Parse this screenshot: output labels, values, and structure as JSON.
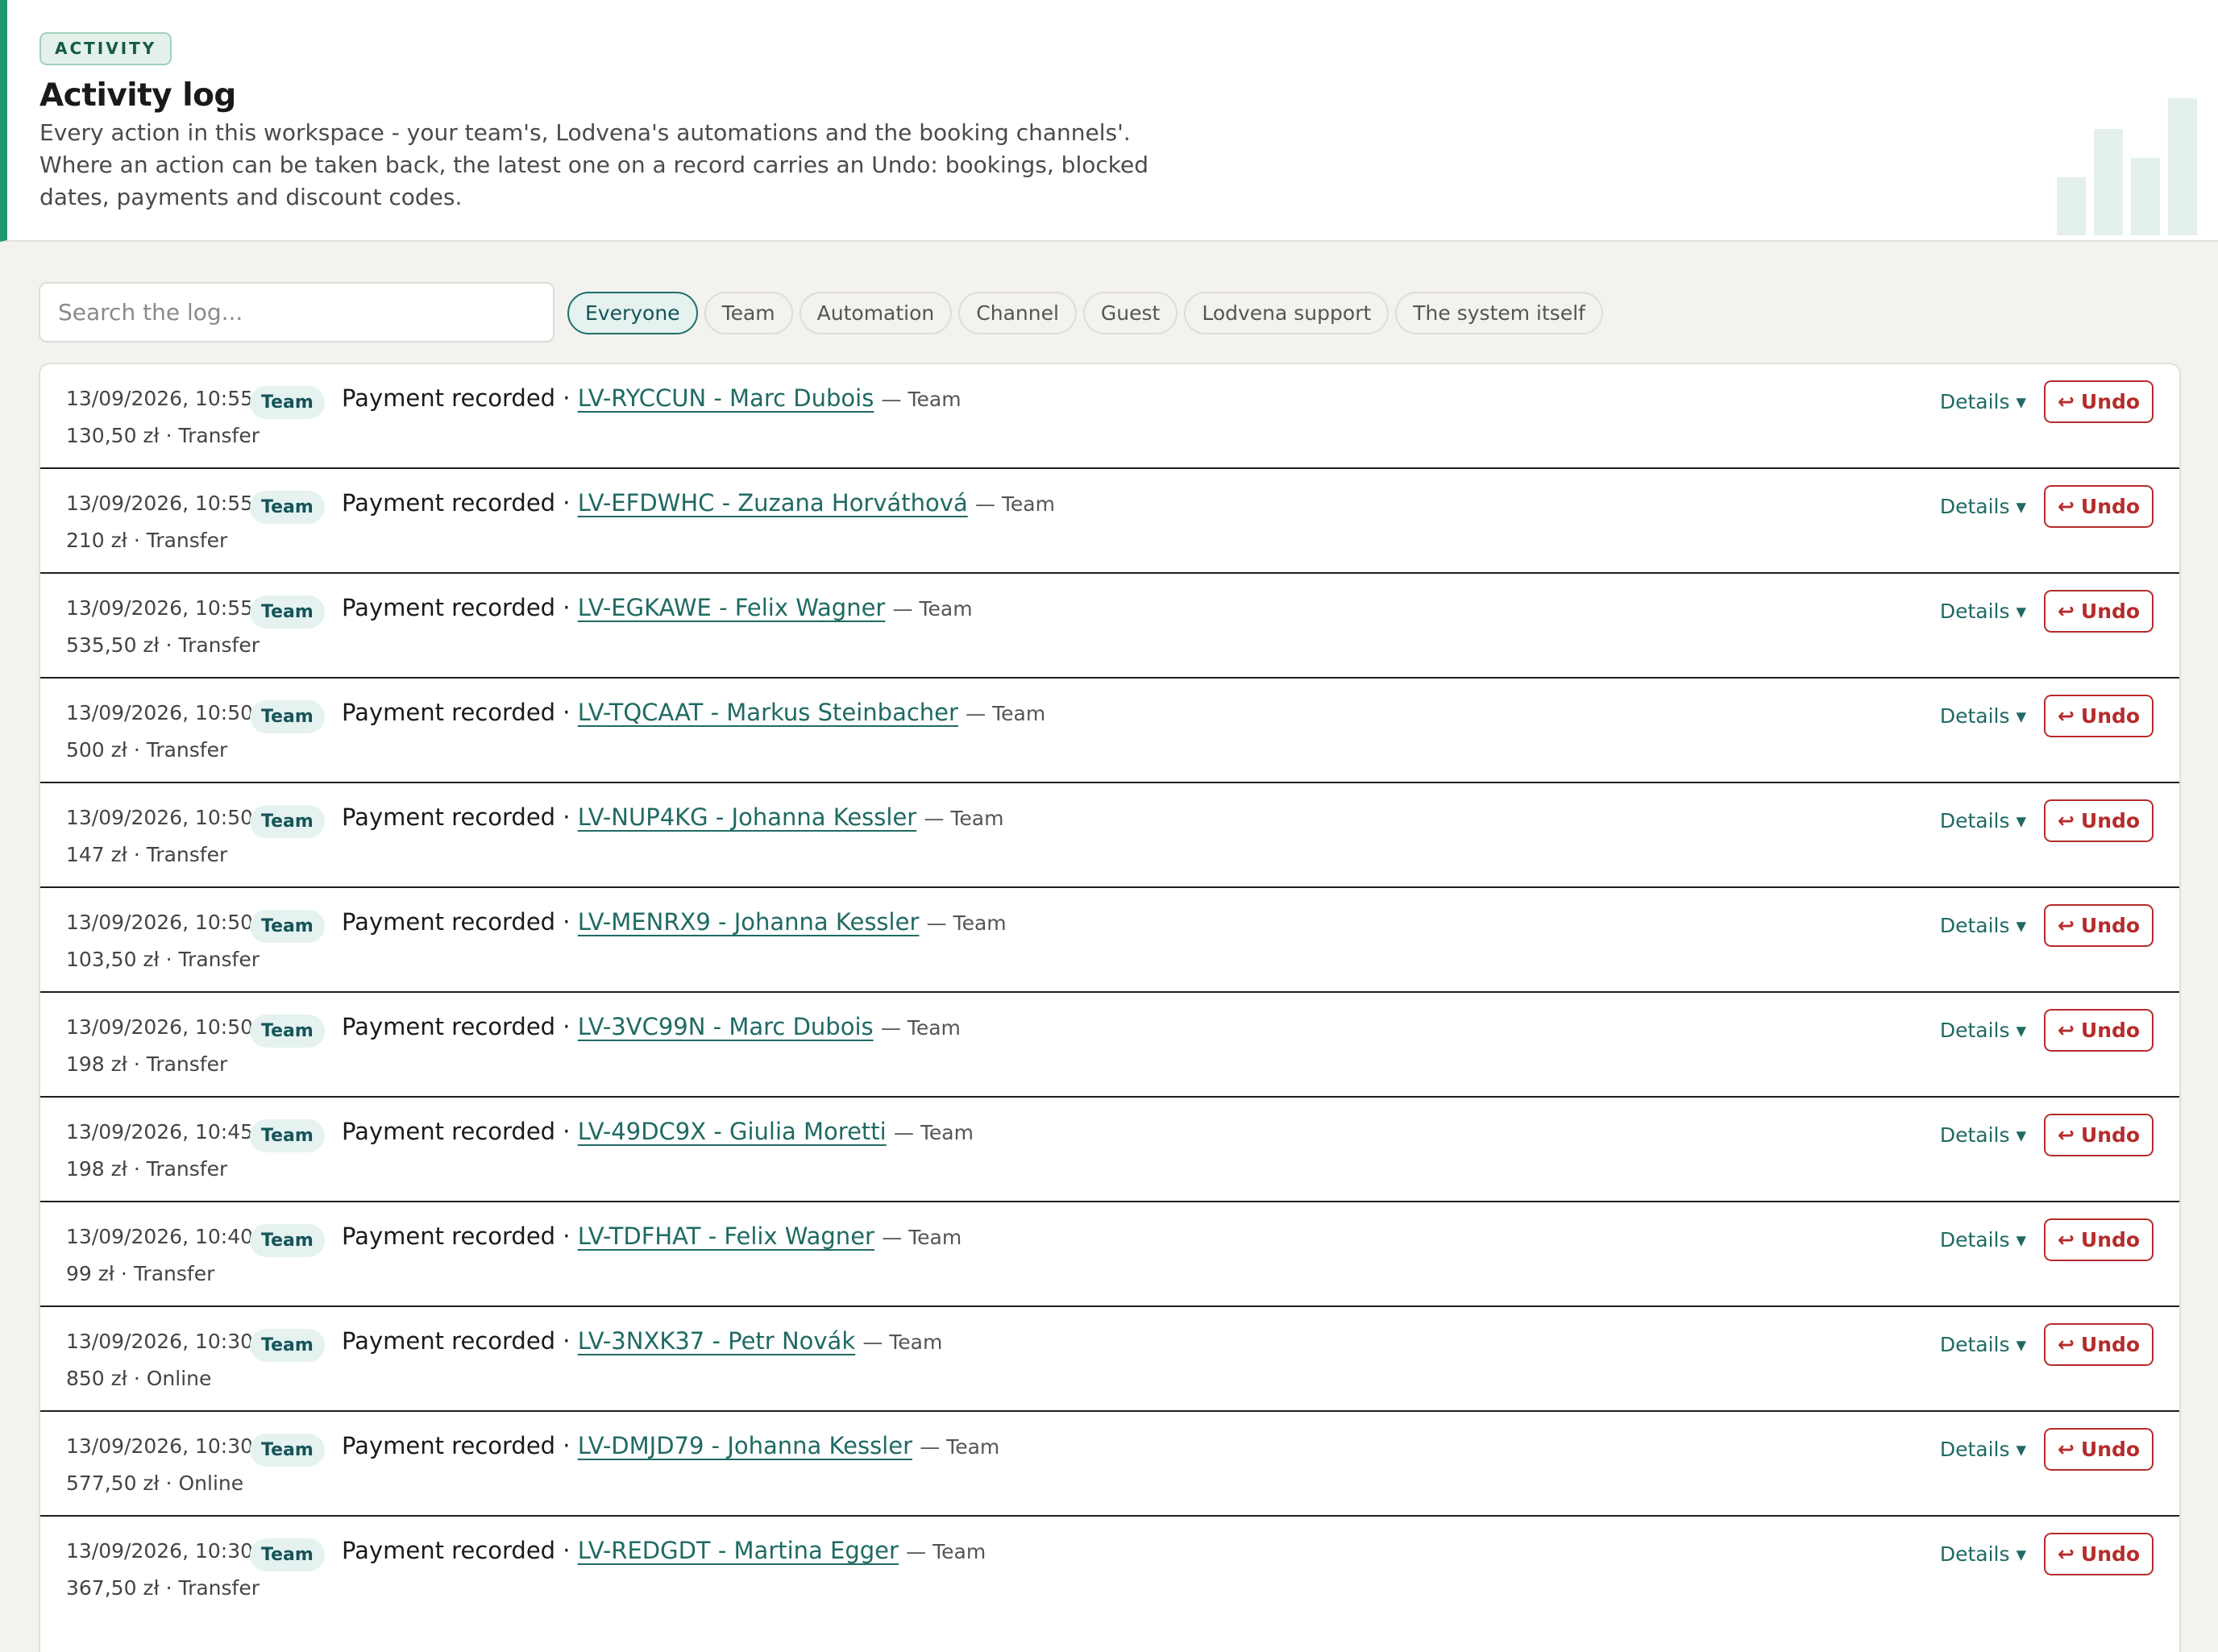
{
  "header": {
    "badge": "ACTIVITY",
    "title": "Activity log",
    "description": "Every action in this workspace - your team's, Lodvena's automations and the booking channels'. Where an action can be taken back, the latest one on a record carries an Undo: bookings, blocked dates, payments and discount codes.",
    "decoration_icon": "bar-chart-icon"
  },
  "search": {
    "placeholder": "Search the log..."
  },
  "filters": [
    {
      "label": "Everyone",
      "active": true
    },
    {
      "label": "Team",
      "active": false
    },
    {
      "label": "Automation",
      "active": false
    },
    {
      "label": "Channel",
      "active": false
    },
    {
      "label": "Guest",
      "active": false
    },
    {
      "label": "Lodvena support",
      "active": false
    },
    {
      "label": "The system itself",
      "active": false
    }
  ],
  "entries": [
    {
      "timestamp": "13/09/2026, 10:55",
      "actor": "Team",
      "action": "Payment recorded",
      "record": "LV-RYCCUN - Marc Dubois",
      "by": "— Team",
      "detail": "130,50 zł · Transfer",
      "details_label": "Details ▾",
      "undo_label": "Undo"
    },
    {
      "timestamp": "13/09/2026, 10:55",
      "actor": "Team",
      "action": "Payment recorded",
      "record": "LV-EFDWHC - Zuzana Horváthová",
      "by": "— Team",
      "detail": "210 zł · Transfer",
      "details_label": "Details ▾",
      "undo_label": "Undo"
    },
    {
      "timestamp": "13/09/2026, 10:55",
      "actor": "Team",
      "action": "Payment recorded",
      "record": "LV-EGKAWE - Felix Wagner",
      "by": "— Team",
      "detail": "535,50 zł · Transfer",
      "details_label": "Details ▾",
      "undo_label": "Undo"
    },
    {
      "timestamp": "13/09/2026, 10:50",
      "actor": "Team",
      "action": "Payment recorded",
      "record": "LV-TQCAAT - Markus Steinbacher",
      "by": "— Team",
      "detail": "500 zł · Transfer",
      "details_label": "Details ▾",
      "undo_label": "Undo"
    },
    {
      "timestamp": "13/09/2026, 10:50",
      "actor": "Team",
      "action": "Payment recorded",
      "record": "LV-NUP4KG - Johanna Kessler",
      "by": "— Team",
      "detail": "147 zł · Transfer",
      "details_label": "Details ▾",
      "undo_label": "Undo"
    },
    {
      "timestamp": "13/09/2026, 10:50",
      "actor": "Team",
      "action": "Payment recorded",
      "record": "LV-MENRX9 - Johanna Kessler",
      "by": "— Team",
      "detail": "103,50 zł · Transfer",
      "details_label": "Details ▾",
      "undo_label": "Undo"
    },
    {
      "timestamp": "13/09/2026, 10:50",
      "actor": "Team",
      "action": "Payment recorded",
      "record": "LV-3VC99N - Marc Dubois",
      "by": "— Team",
      "detail": "198 zł · Transfer",
      "details_label": "Details ▾",
      "undo_label": "Undo"
    },
    {
      "timestamp": "13/09/2026, 10:45",
      "actor": "Team",
      "action": "Payment recorded",
      "record": "LV-49DC9X - Giulia Moretti",
      "by": "— Team",
      "detail": "198 zł · Transfer",
      "details_label": "Details ▾",
      "undo_label": "Undo"
    },
    {
      "timestamp": "13/09/2026, 10:40",
      "actor": "Team",
      "action": "Payment recorded",
      "record": "LV-TDFHAT - Felix Wagner",
      "by": "— Team",
      "detail": "99 zł · Transfer",
      "details_label": "Details ▾",
      "undo_label": "Undo"
    },
    {
      "timestamp": "13/09/2026, 10:30",
      "actor": "Team",
      "action": "Payment recorded",
      "record": "LV-3NXK37 - Petr Novák",
      "by": "— Team",
      "detail": "850 zł · Online",
      "details_label": "Details ▾",
      "undo_label": "Undo"
    },
    {
      "timestamp": "13/09/2026, 10:30",
      "actor": "Team",
      "action": "Payment recorded",
      "record": "LV-DMJD79 - Johanna Kessler",
      "by": "— Team",
      "detail": "577,50 zł · Online",
      "details_label": "Details ▾",
      "undo_label": "Undo"
    },
    {
      "timestamp": "13/09/2026, 10:30",
      "actor": "Team",
      "action": "Payment recorded",
      "record": "LV-REDGDT - Martina Egger",
      "by": "— Team",
      "detail": "367,50 zł · Transfer",
      "details_label": "Details ▾",
      "undo_label": "Undo"
    }
  ],
  "colors": {
    "accent": "#1f9a6c",
    "link": "#1f6a63",
    "undo": "#b62b2b",
    "chip_active_bg": "#e5f2f0"
  }
}
